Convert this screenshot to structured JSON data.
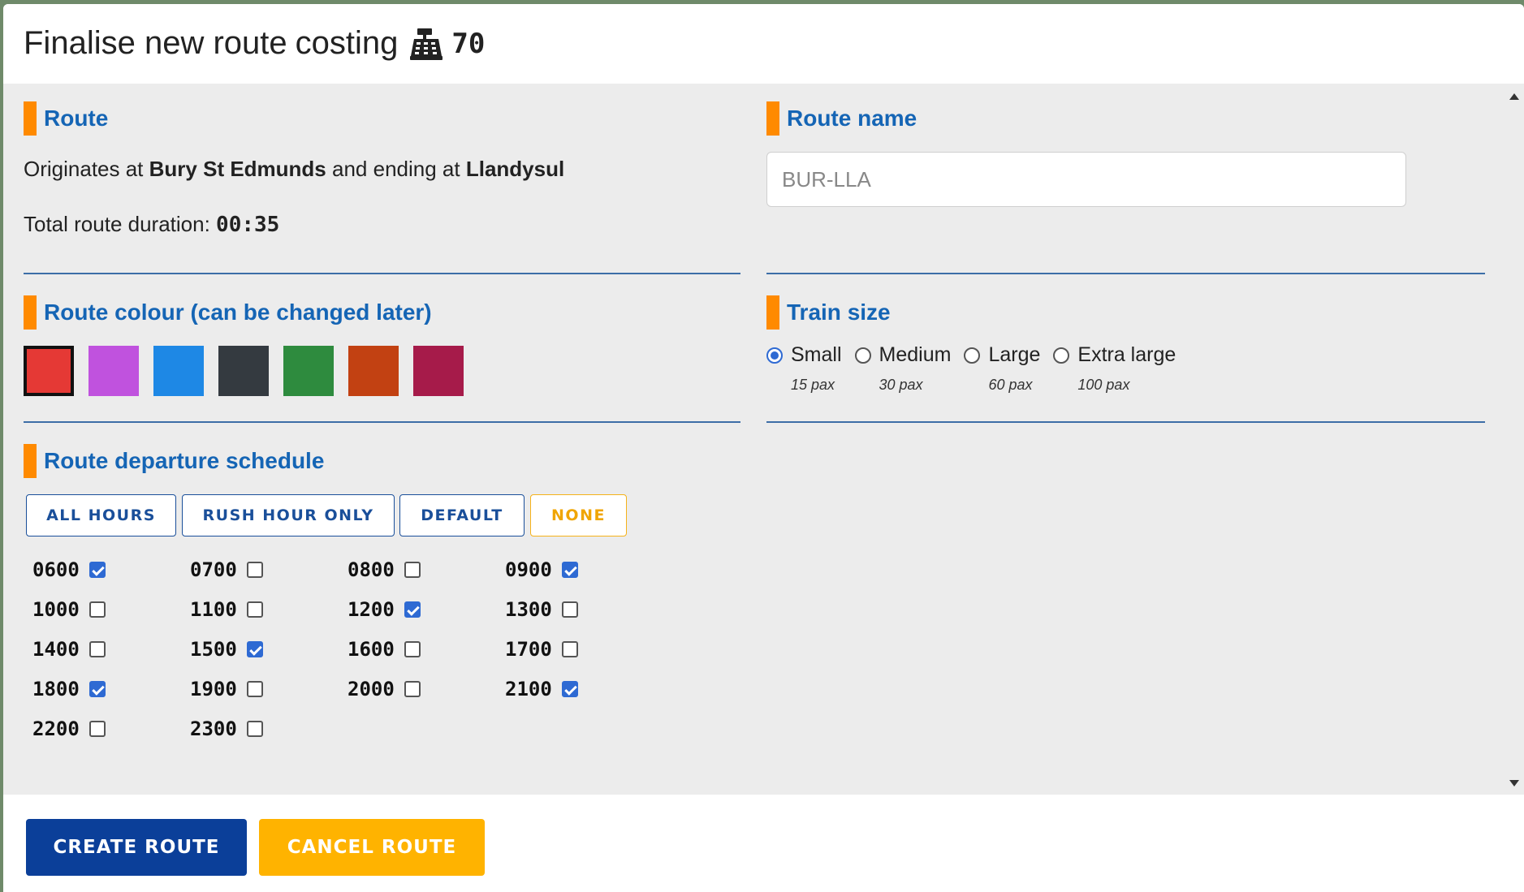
{
  "header": {
    "title": "Finalise new route",
    "cost_label": "costing",
    "cost_icon": "cash-register-icon",
    "cost_value": "70"
  },
  "route": {
    "heading": "Route",
    "originates_prefix": "Originates at",
    "origin": "Bury St Edmunds",
    "ending_mid": "and ending at",
    "destination": "Llandysul",
    "duration_label": "Total route duration:",
    "duration_value": "00:35"
  },
  "route_name": {
    "heading": "Route name",
    "placeholder": "BUR-LLA"
  },
  "colour": {
    "heading": "Route colour (can be changed later)",
    "swatches": [
      "#e53935",
      "#c052de",
      "#1e88e5",
      "#343a40",
      "#2e8b3e",
      "#c24112",
      "#a61b4a"
    ],
    "selected_index": 0
  },
  "train_size": {
    "heading": "Train size",
    "options": [
      {
        "label": "Small",
        "pax": "15 pax",
        "checked": true
      },
      {
        "label": "Medium",
        "pax": "30 pax",
        "checked": false
      },
      {
        "label": "Large",
        "pax": "60 pax",
        "checked": false
      },
      {
        "label": "Extra large",
        "pax": "100 pax",
        "checked": false
      }
    ]
  },
  "schedule": {
    "heading": "Route departure schedule",
    "presets": {
      "all": "ALL HOURS",
      "rush": "RUSH HOUR ONLY",
      "default": "DEFAULT",
      "none": "NONE"
    },
    "hours": [
      {
        "label": "0600",
        "checked": true
      },
      {
        "label": "0700",
        "checked": false
      },
      {
        "label": "0800",
        "checked": false
      },
      {
        "label": "0900",
        "checked": true
      },
      {
        "label": "1000",
        "checked": false
      },
      {
        "label": "1100",
        "checked": false
      },
      {
        "label": "1200",
        "checked": true
      },
      {
        "label": "1300",
        "checked": false
      },
      {
        "label": "1400",
        "checked": false
      },
      {
        "label": "1500",
        "checked": true
      },
      {
        "label": "1600",
        "checked": false
      },
      {
        "label": "1700",
        "checked": false
      },
      {
        "label": "1800",
        "checked": true
      },
      {
        "label": "1900",
        "checked": false
      },
      {
        "label": "2000",
        "checked": false
      },
      {
        "label": "2100",
        "checked": true
      },
      {
        "label": "2200",
        "checked": false
      },
      {
        "label": "2300",
        "checked": false
      }
    ]
  },
  "footer": {
    "create_label": "CREATE ROUTE",
    "cancel_label": "CANCEL ROUTE"
  },
  "colors": {
    "accent": "#1565b5",
    "section_bar": "#ff8a00",
    "primary_button": "#0b3f99",
    "secondary_button": "#ffb300"
  }
}
